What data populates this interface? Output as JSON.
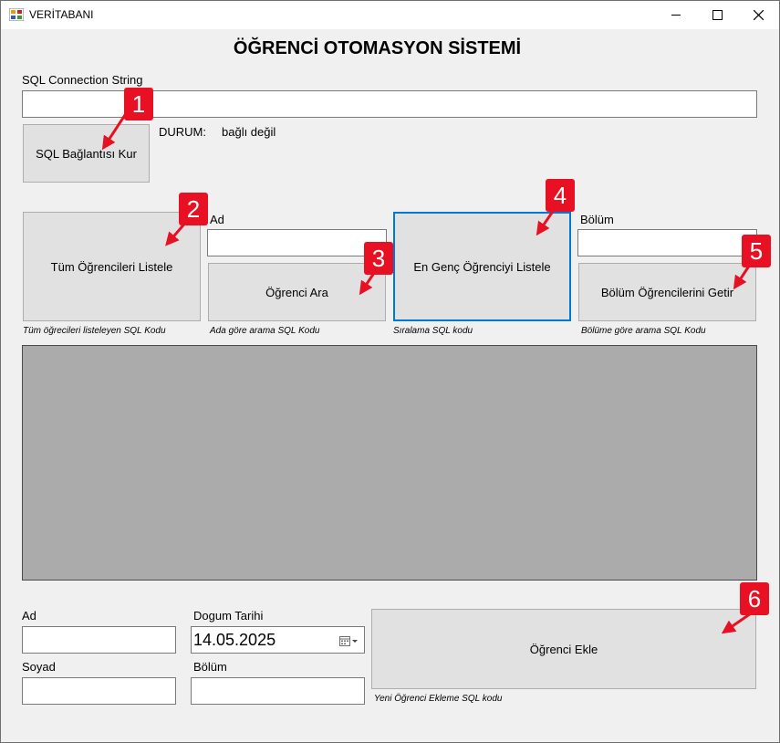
{
  "window": {
    "title": "VERİTABANI",
    "controls": {
      "minimize": "—",
      "maximize": "☐",
      "close": "✕"
    }
  },
  "header": {
    "title": "ÖĞRENCİ OTOMASYON SİSTEMİ"
  },
  "connection": {
    "label": "SQL Connection String",
    "value": "",
    "connect_button": "SQL Bağlantısı Kur",
    "status_label": "DURUM:",
    "status_value": "bağlı değil"
  },
  "query": {
    "list_all_button": "Tüm Öğrencileri Listele",
    "list_all_note": "Tüm öğrecileri listeleyen SQL Kodu",
    "name_label": "Ad",
    "name_value": "",
    "search_button": "Öğrenci Ara",
    "search_note": "Ada göre arama SQL Kodu",
    "youngest_button": "En Genç Öğrenciyi Listele",
    "youngest_note": "Sıralama SQL kodu",
    "dept_label": "Bölüm",
    "dept_value": "",
    "dept_button": "Bölüm Öğrencilerini Getir",
    "dept_note": "Bölüme göre arama SQL Kodu"
  },
  "add_form": {
    "name_label": "Ad",
    "name_value": "",
    "surname_label": "Soyad",
    "surname_value": "",
    "birth_label": "Dogum Tarihi",
    "birth_value": "14.05.2025",
    "dept_label": "Bölüm",
    "dept_value": "",
    "add_button": "Öğrenci Ekle",
    "add_note": "Yeni Öğrenci Ekleme SQL kodu"
  },
  "annotations": [
    "1",
    "2",
    "3",
    "4",
    "5",
    "6"
  ],
  "colors": {
    "marker_red": "#e81123",
    "focus_blue": "#0078d7",
    "grid_gray": "#ababab"
  }
}
